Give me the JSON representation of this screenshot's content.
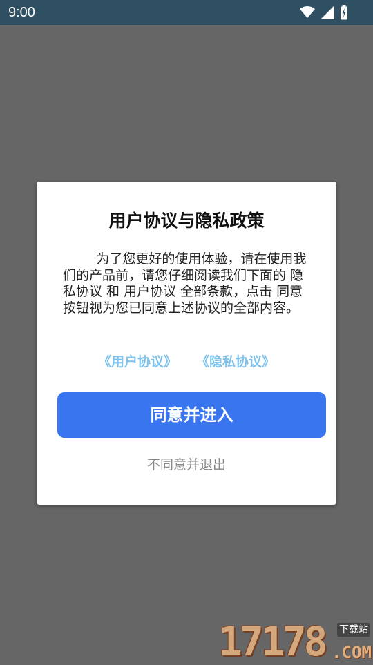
{
  "status_bar": {
    "time": "9:00",
    "icons": [
      "wifi-icon",
      "signal-icon",
      "battery-charging-icon"
    ],
    "background": "#2f4f63"
  },
  "dialog": {
    "title": "用户协议与隐私政策",
    "body": "        为了您更好的使用体验，请在使用我们的产品前，请您仔细阅读我们下面的 隐私协议 和 用户协议 全部条款，点击 同意 按钮视为您已同意上述协议的全部内容。",
    "links": {
      "user_agreement": "《用户协议》",
      "privacy_agreement": "《隐私协议》",
      "color": "#7fc3ec"
    },
    "agree_button": "同意并进入",
    "decline_button": "不同意并退出",
    "accent_color": "#3a75f0"
  },
  "watermark": {
    "digits": "17178",
    "label": "下载站",
    "domain": ".COM"
  }
}
